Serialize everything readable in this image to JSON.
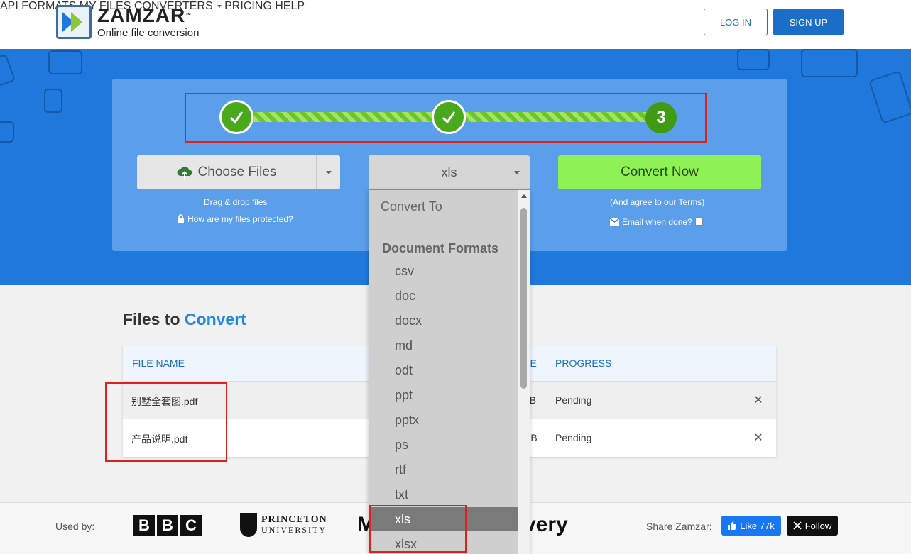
{
  "brand": {
    "name": "ZAMZAR",
    "trademark": "™",
    "tagline": "Online file conversion"
  },
  "nav": {
    "items": [
      "API",
      "FORMATS",
      "MY FILES",
      "CONVERTERS",
      "PRICING",
      "HELP"
    ],
    "login": "LOG IN",
    "signup": "SIGN UP"
  },
  "steps": {
    "done_mark": "✓",
    "current": "3"
  },
  "upload": {
    "choose_label": "Choose Files",
    "drag_hint": "Drag & drop files",
    "protect_link": "How are my files protected?"
  },
  "format_select": {
    "value": "xls"
  },
  "convert": {
    "button_label": "Convert Now",
    "agree_prefix": "(And agree to our ",
    "terms_link": "Terms",
    "agree_suffix": ")",
    "email_label": "Email when done?"
  },
  "dropdown": {
    "header": "Convert To",
    "group": "Document Formats",
    "options": [
      "csv",
      "doc",
      "docx",
      "md",
      "odt",
      "ppt",
      "pptx",
      "ps",
      "rtf",
      "txt",
      "xls",
      "xlsx"
    ],
    "selected": "xls"
  },
  "files": {
    "title_prefix": "Files to",
    "title_accent": "Convert",
    "columns": {
      "name": "FILE NAME",
      "size_partial": "ZE",
      "progress": "PROGRESS"
    },
    "rows": [
      {
        "name": "别墅全套图.pdf",
        "size_partial": "1B",
        "progress": "Pending"
      },
      {
        "name": "产品说明.pdf",
        "size_partial": "KB",
        "progress": "Pending"
      }
    ],
    "remove_glyph": "✕"
  },
  "footer": {
    "used_by": "Used by:",
    "logos": {
      "bbc": [
        "B",
        "B",
        "C"
      ],
      "princeton_l1": "PRINCETON",
      "princeton_l2": "UNIVERSITY",
      "partial_m": "M",
      "partial_very": "very"
    },
    "share_label": "Share Zamzar:",
    "like_label": "Like 77k",
    "follow_label": "Follow"
  },
  "colors": {
    "accent_blue": "#1a6ec8",
    "hero_blue": "#1f78dc",
    "convert_green": "#8ef254",
    "step_green": "#4aa81c",
    "highlight_red": "#e0201c"
  }
}
